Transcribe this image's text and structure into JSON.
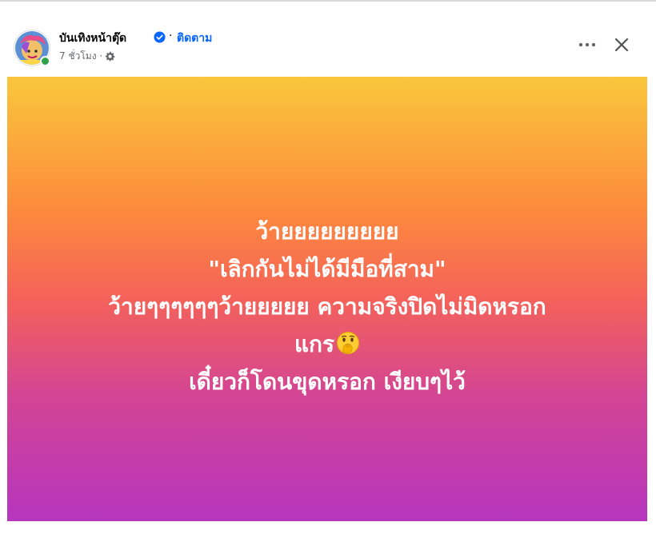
{
  "post": {
    "page_name": "บันเทิงหน้าตุ๊ด",
    "separator": "·",
    "follow_label": "ติดตาม",
    "timestamp": "7 ชั่วโมง ·",
    "audience_icon": "gear-icon",
    "verified_icon": "verified-badge-icon",
    "more_icon": "more-options-icon",
    "close_icon": "close-icon"
  },
  "card": {
    "lines": [
      "ว้ายยยยยยยยย",
      "\"เลิกกันไม่ได้มีมือที่สาม\"",
      "ว้ายๆๆๆๆๆๆว้ายยยยย ความจริงปิดไม่มิดหรอก",
      "แกร",
      "เดี๋ยวก็โดนขุดหรอก เงียบๆไว้"
    ],
    "emoji_icon": "face-with-hand-over-mouth-emoji",
    "gradient_colors": [
      "#f9c73b",
      "#fd8a3c",
      "#f4625a",
      "#d34494",
      "#b535be"
    ]
  },
  "colors": {
    "link_blue": "#0866ff",
    "online_green": "#31a24c",
    "text_secondary": "#65676b"
  }
}
